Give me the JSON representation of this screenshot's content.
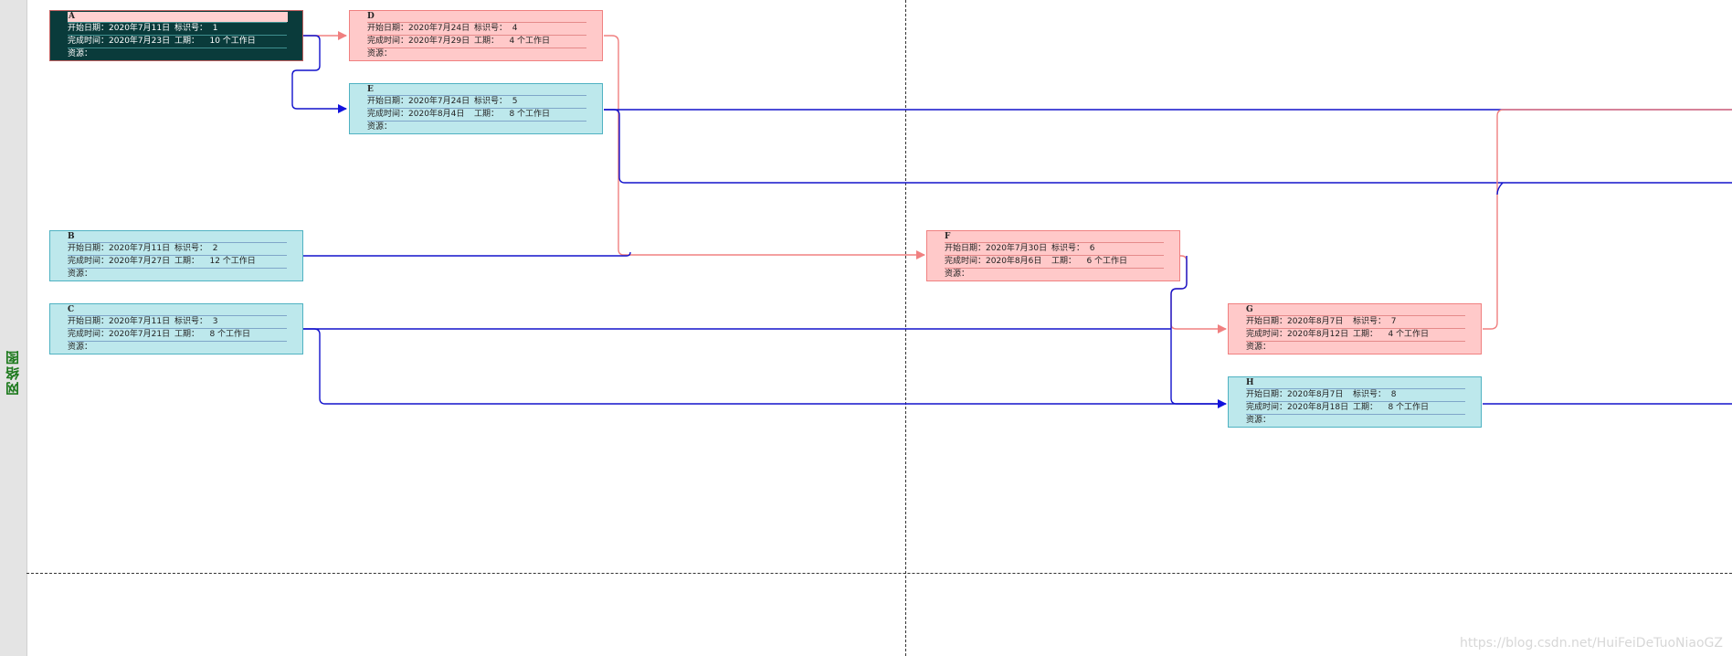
{
  "view_label": "网络图",
  "labels": {
    "start": "开始日期：",
    "finish": "完成时间：",
    "id": "标识号：",
    "duration": "工期：",
    "resource": "资源："
  },
  "colors": {
    "blue_fill": "#bde8ec",
    "red_fill": "#ffc9c9",
    "selected_fill": "#0a3b3b",
    "blue_link": "#1212cc",
    "red_link": "#f08080"
  },
  "tasks": [
    {
      "name": "A",
      "start": "2020年7月11日",
      "id": "1",
      "finish": "2020年7月23日",
      "duration": "10 个工作日",
      "style": "selected"
    },
    {
      "name": "D",
      "start": "2020年7月24日",
      "id": "4",
      "finish": "2020年7月29日",
      "duration": "4 个工作日",
      "style": "critical"
    },
    {
      "name": "E",
      "start": "2020年7月24日",
      "id": "5",
      "finish": "2020年8月4日",
      "duration": "8 个工作日",
      "style": "normal"
    },
    {
      "name": "B",
      "start": "2020年7月11日",
      "id": "2",
      "finish": "2020年7月27日",
      "duration": "12 个工作日",
      "style": "normal"
    },
    {
      "name": "C",
      "start": "2020年7月11日",
      "id": "3",
      "finish": "2020年7月21日",
      "duration": "8 个工作日",
      "style": "normal"
    },
    {
      "name": "F",
      "start": "2020年7月30日",
      "id": "6",
      "finish": "2020年8月6日",
      "duration": "6 个工作日",
      "style": "critical"
    },
    {
      "name": "G",
      "start": "2020年8月7日",
      "id": "7",
      "finish": "2020年8月12日",
      "duration": "4 个工作日",
      "style": "critical"
    },
    {
      "name": "H",
      "start": "2020年8月7日",
      "id": "8",
      "finish": "2020年8月18日",
      "duration": "8 个工作日",
      "style": "normal"
    }
  ],
  "watermark": "https://blog.csdn.net/HuiFeiDeTuoNiaoGZ"
}
